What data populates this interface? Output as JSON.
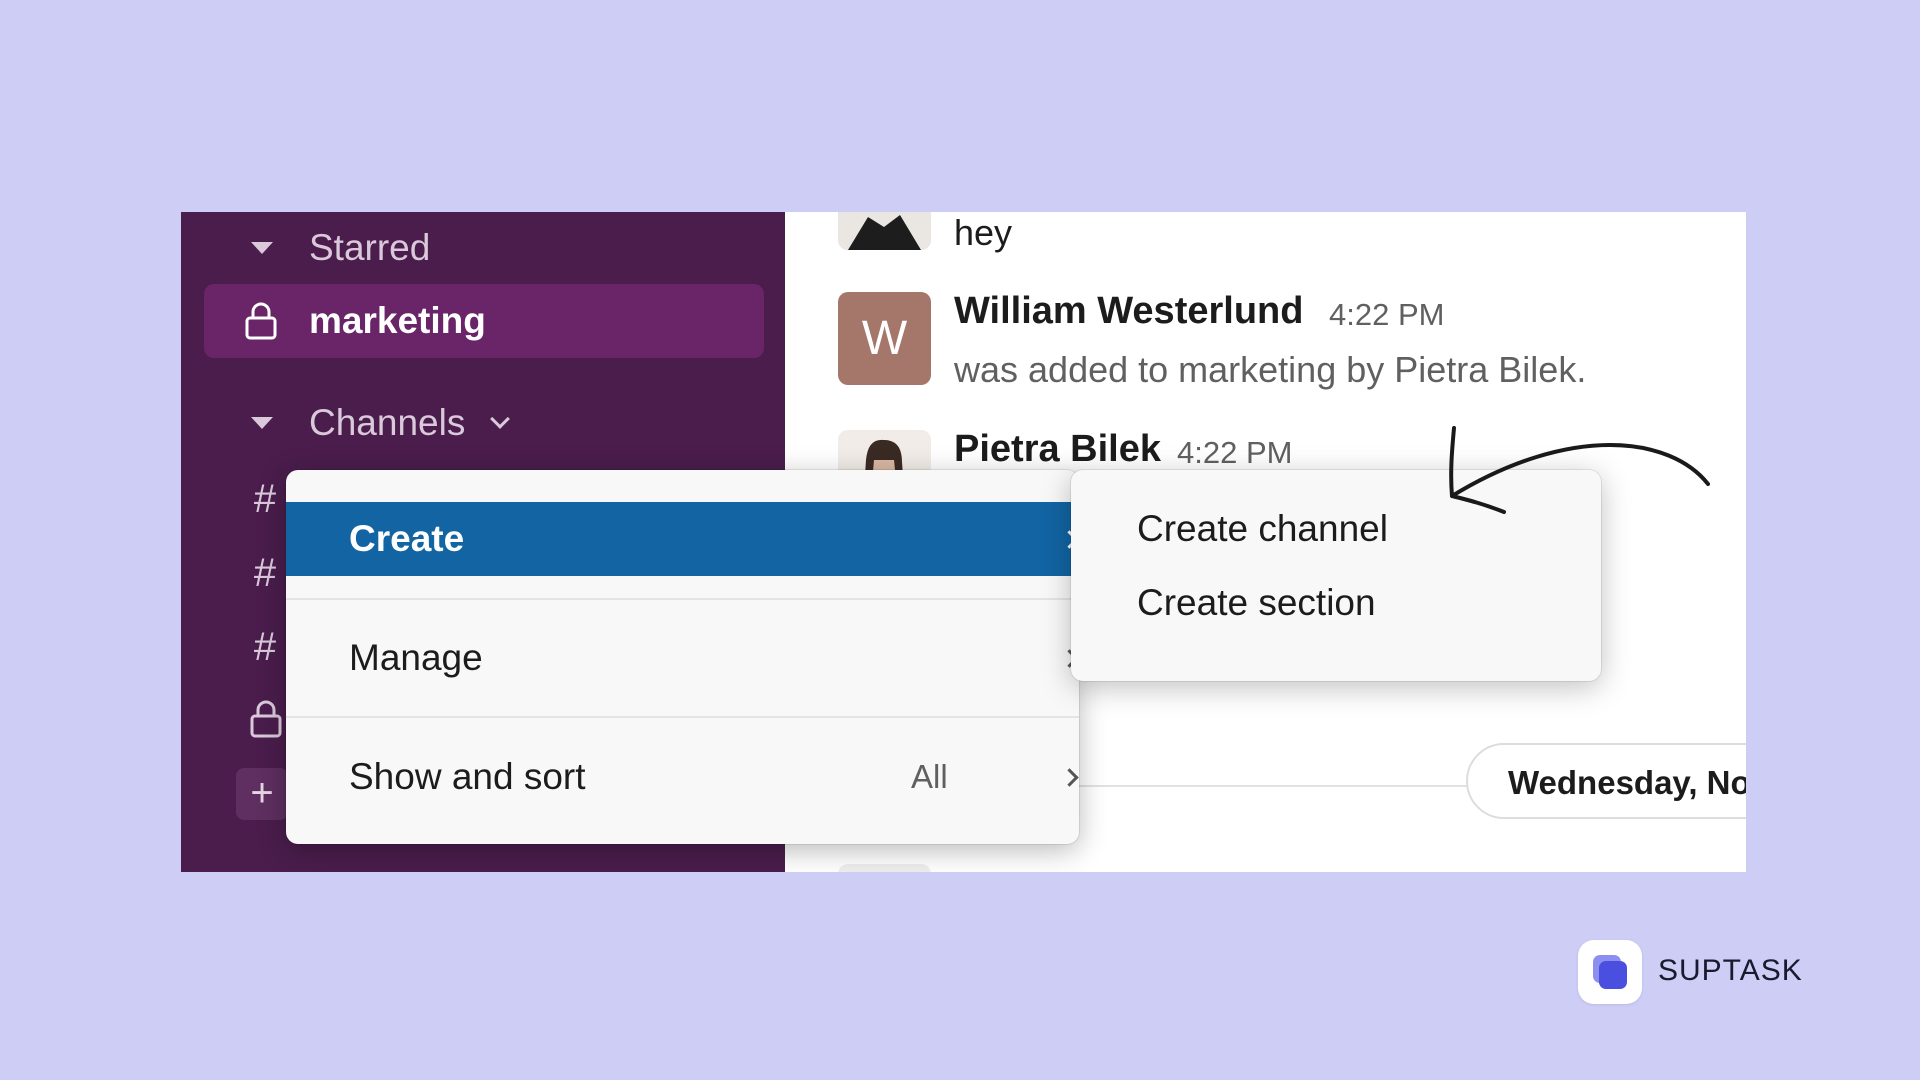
{
  "sidebar": {
    "starred_label": "Starred",
    "active_channel": "marketing",
    "channels_label": "Channels"
  },
  "chat": {
    "first_message": "hey",
    "messages": [
      {
        "avatar_letter": "W",
        "author": "William Westerlund",
        "time": "4:22 PM",
        "text": "was added to marketing by Pietra Bilek."
      },
      {
        "author": "Pietra Bilek",
        "time": "4:22 PM"
      }
    ],
    "day_divider": "Wednesday, No"
  },
  "context_menu": {
    "items": [
      {
        "label": "Create",
        "highlighted": true
      },
      {
        "label": "Manage"
      },
      {
        "label": "Show and sort",
        "value": "All"
      }
    ],
    "highlight_color": "#1264a3"
  },
  "submenu": {
    "items": [
      "Create channel",
      "Create section"
    ]
  },
  "brand": {
    "name": "SUPTASK",
    "accent": "#4b4fe0"
  },
  "colors": {
    "background": "#cdcdf5",
    "sidebar": "#4a1d4c",
    "active_item": "#6a2468"
  }
}
